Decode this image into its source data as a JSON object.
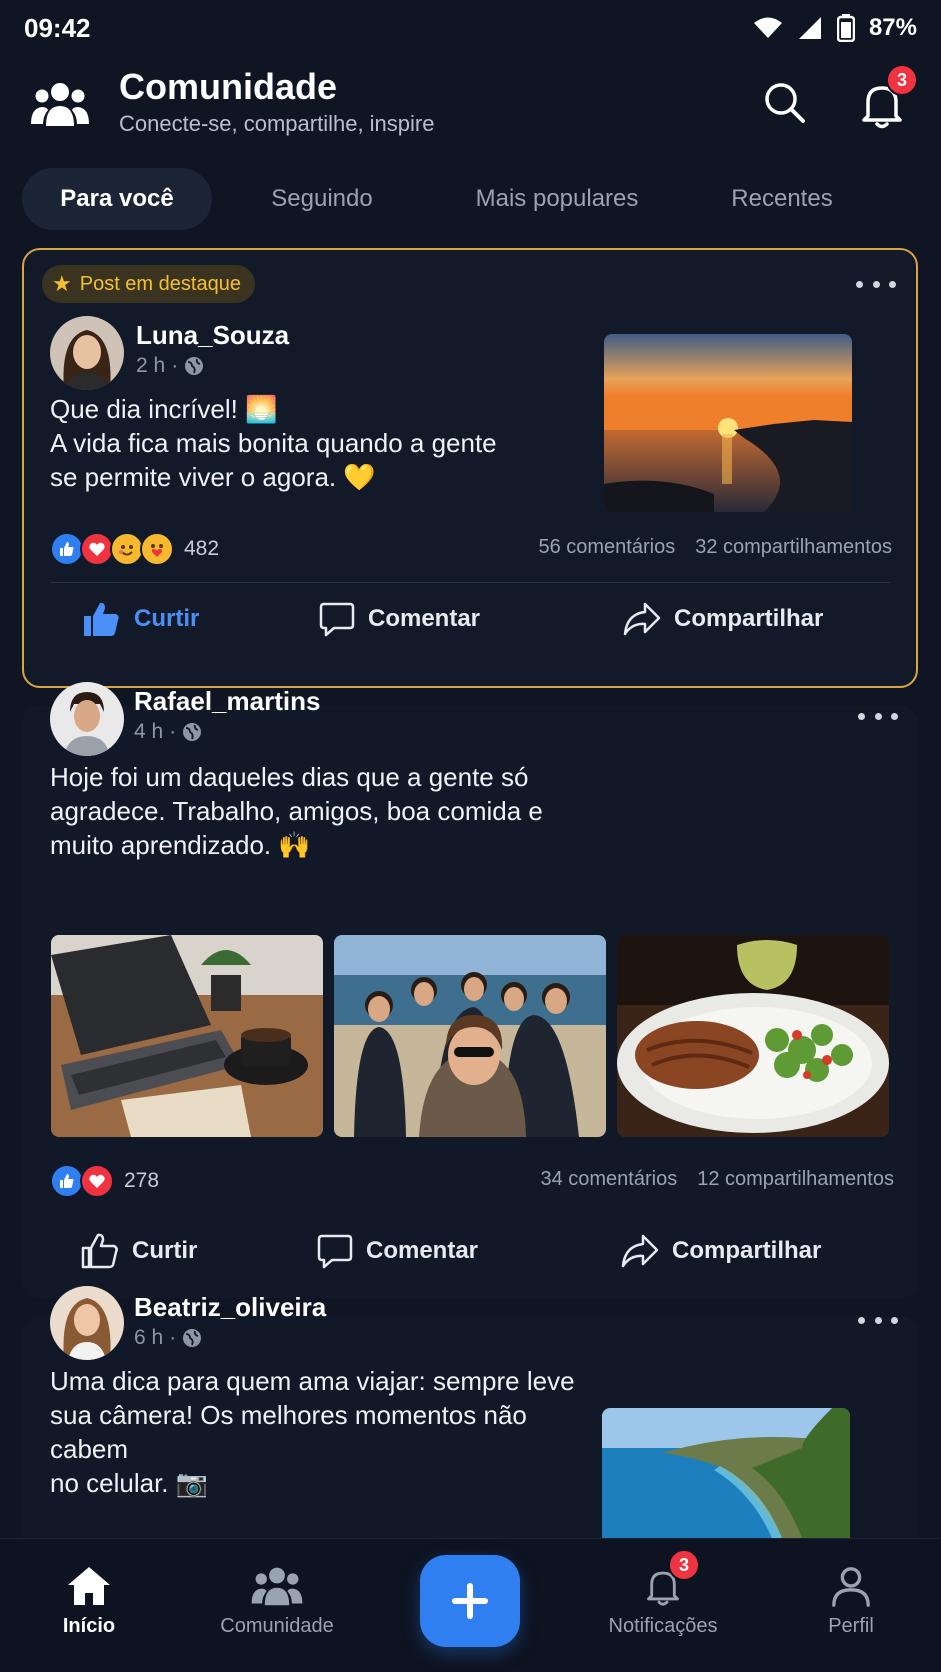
{
  "status_bar": {
    "time": "09:42",
    "battery": "87%"
  },
  "header": {
    "title": "Comunidade",
    "subtitle": "Conecte-se, compartilhe, inspire",
    "notification_count": "3"
  },
  "tabs": [
    {
      "label": "Para você",
      "active": true
    },
    {
      "label": "Seguindo",
      "active": false
    },
    {
      "label": "Mais populares",
      "active": false
    },
    {
      "label": "Recentes",
      "active": false
    }
  ],
  "posts": [
    {
      "featured_label": "Post em destaque",
      "author": "Luna_Souza",
      "time": "2 h",
      "text": "Que dia incrível! 🌅\nA vida fica mais bonita quando a gente\nse permite viver o agora. 💛",
      "reaction_count": "482",
      "comments": "56 comentários",
      "shares": "32 compartilhamentos",
      "like_label": "Curtir",
      "comment_label": "Comentar",
      "share_label": "Compartilhar"
    },
    {
      "author": "Rafael_martins",
      "time": "4 h",
      "text": "Hoje foi um daqueles dias que a gente só\nagradece. Trabalho, amigos, boa comida e\nmuito aprendizado. 🙌",
      "reaction_count": "278",
      "comments": "34 comentários",
      "shares": "12 compartilhamentos",
      "like_label": "Curtir",
      "comment_label": "Comentar",
      "share_label": "Compartilhar"
    },
    {
      "author": "Beatriz_oliveira",
      "time": "6 h",
      "text": "Uma dica para quem ama viajar: sempre leve\nsua câmera! Os melhores momentos não cabem\nno celular. 📷"
    }
  ],
  "bottom_nav": {
    "home": "Início",
    "community": "Comunidade",
    "notifications": "Notificações",
    "notifications_count": "3",
    "profile": "Perfil"
  },
  "colors": {
    "accent": "#2f7ff0",
    "featured_border": "#d9a441",
    "badge": "#ef3340",
    "background": "#0f1522"
  }
}
